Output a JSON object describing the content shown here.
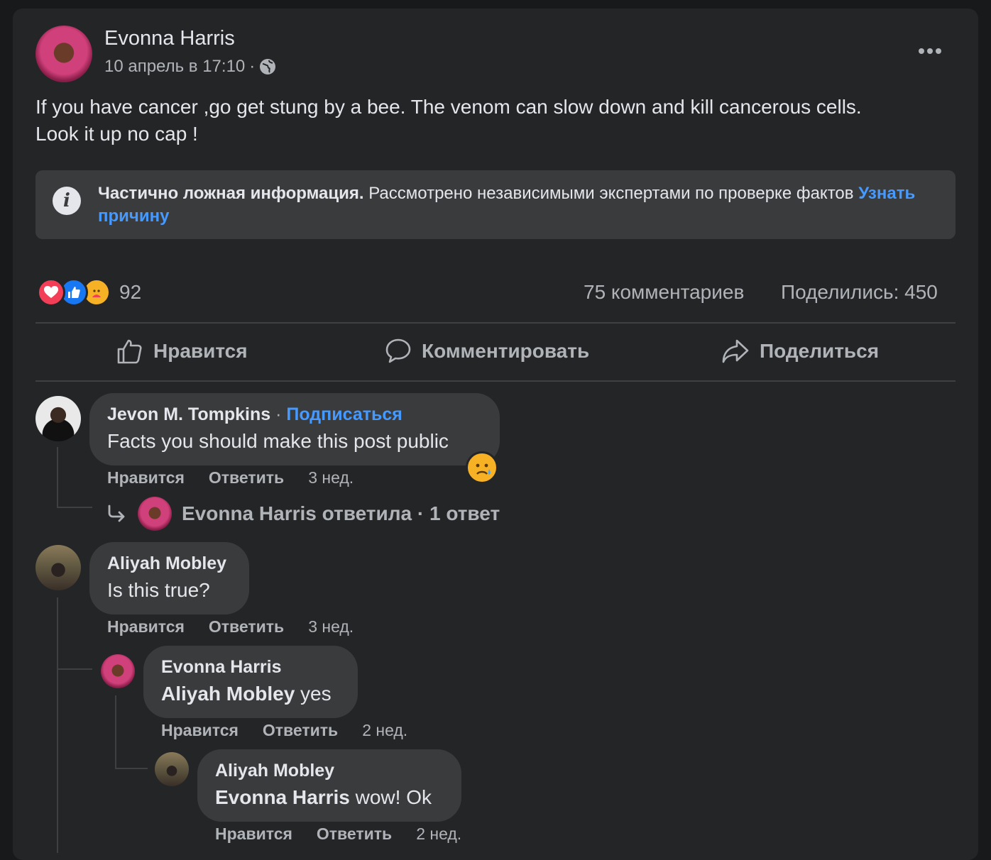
{
  "post": {
    "author": "Evonna Harris",
    "timestamp": "10 апрель в 17:10",
    "visibility_icon": "globe-icon",
    "text_line1": "If you have cancer ,go get stung by a bee. The venom can slow down and kill cancerous cells.",
    "text_line2": "Look it up no cap !"
  },
  "factcheck": {
    "title": "Частично ложная информация.",
    "text": " Рассмотрено независимыми экспертами по проверке фактов ",
    "link": "Узнать причину"
  },
  "stats": {
    "reactions_count": "92",
    "comments": "75 комментариев",
    "shares": "Поделились: 450"
  },
  "actions": {
    "like": "Нравится",
    "comment": "Комментировать",
    "share": "Поделиться"
  },
  "comments": [
    {
      "author": "Jevon M. Tompkins",
      "separator": " · ",
      "follow": "Подписаться",
      "text": "Facts you should make this post public",
      "like": "Нравится",
      "reply": "Ответить",
      "time": "3 нед.",
      "reply_summary": "Evonna Harris ответила · 1 ответ"
    },
    {
      "author": "Aliyah Mobley",
      "text": "Is this true?",
      "like": "Нравится",
      "reply": "Ответить",
      "time": "3 нед."
    },
    {
      "author": "Evonna Harris",
      "mention": "Aliyah Mobley",
      "text": " yes",
      "like": "Нравится",
      "reply": "Ответить",
      "time": "2 нед."
    },
    {
      "author": "Aliyah Mobley",
      "mention": "Evonna Harris",
      "text": " wow! Ok",
      "like": "Нравится",
      "reply": "Ответить",
      "time": "2 нед."
    }
  ],
  "colors": {
    "background": "#18191a",
    "card": "#242526",
    "bubble": "#3a3b3c",
    "link": "#4599ff",
    "secondary_text": "#b0b3b8"
  }
}
